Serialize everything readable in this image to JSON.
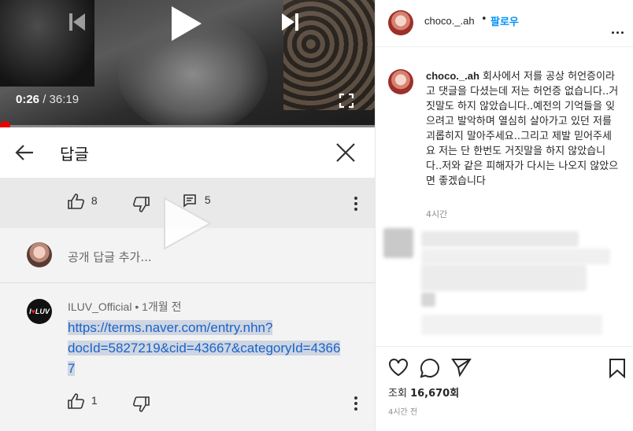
{
  "player": {
    "current_time": "0:26",
    "separator": " / ",
    "duration": "36:19",
    "progress_fraction": 0.012
  },
  "reply_panel": {
    "title": "답글",
    "parent_comment": {
      "like_count": "8",
      "reply_count": "5"
    },
    "add_reply_placeholder": "공개 답글 추가...",
    "reply": {
      "author_avatar_text_a": "I",
      "author_avatar_text_b": "♥",
      "author_avatar_text_c": "LUV",
      "author": "ILUV_Official",
      "meta_sep": " • ",
      "time": "1개월 전",
      "link_line1": "https://terms.naver.com/entry.nhn?",
      "link_line2": "docId=5827219&cid=43667&categoryId=4366",
      "link_line3": "7",
      "like_count": "1"
    }
  },
  "instagram": {
    "username": "choco._.ah",
    "dot": "•",
    "follow_label": "팔로우",
    "caption_username": "choco._.ah",
    "caption_text": " 회사에서 저를 공상 허언증이라고 댓글을 다셨는데 저는 허언증 없습니다..거짓말도 하지 않았습니다..예전의 기억들을 잊으려고 발악하며 열심히 살아가고 있던 저를 괴롭히지 말아주세요..그리고 제발 믿어주세요 저는 단 한번도 거짓말을 하지 않았습니다..저와 같은 피해자가 다시는 나오지 않았으면 좋겠습니다",
    "caption_time": "4시간",
    "views_label": "조회",
    "views_count": "16,670회",
    "post_time": "4시간 전"
  },
  "colors": {
    "youtube_red": "#ee0000",
    "link_blue": "#1a63c9",
    "ig_blue": "#0095f6"
  }
}
